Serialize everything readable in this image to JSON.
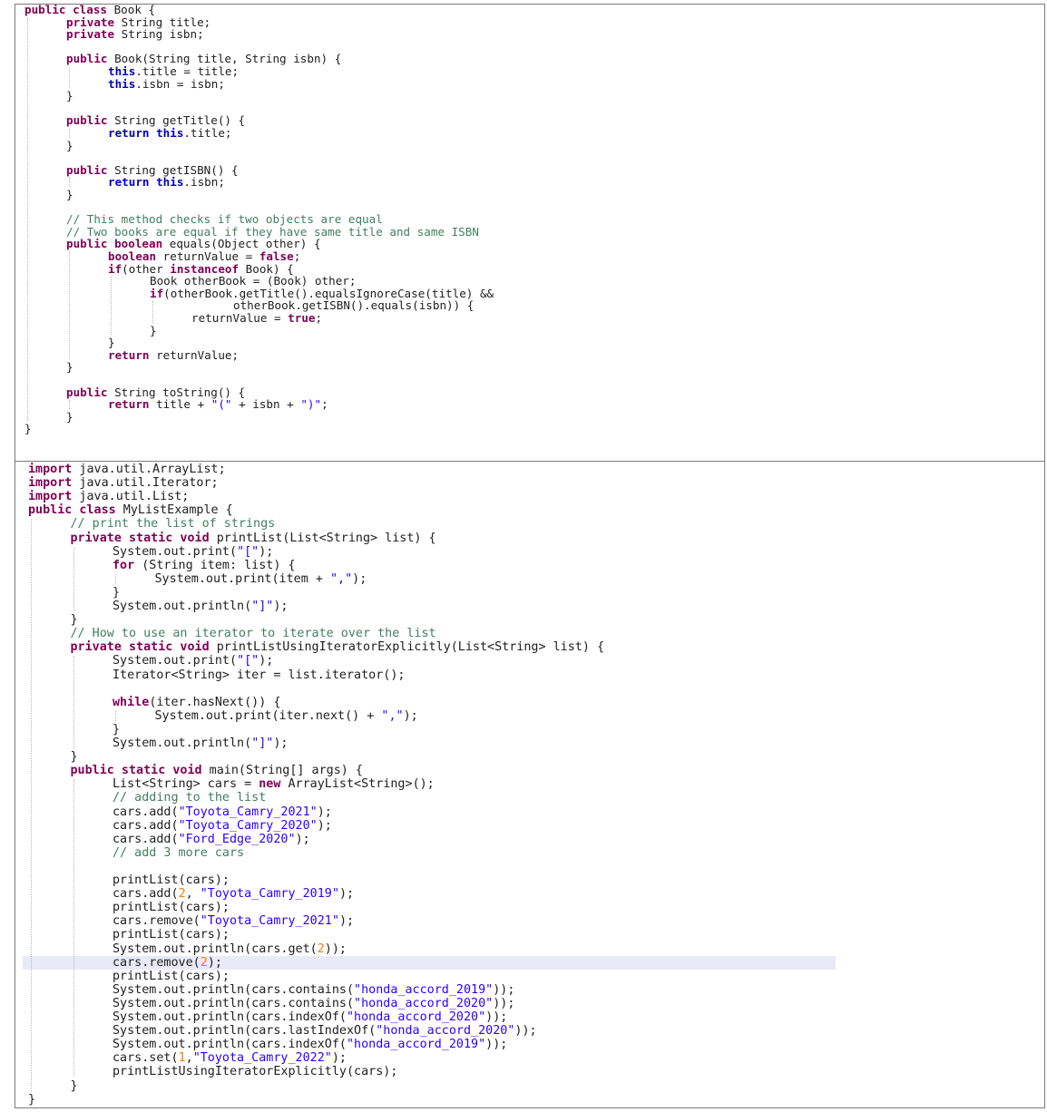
{
  "panel1": {
    "lines": [
      {
        "indent": 0,
        "tokens": [
          {
            "t": "public class",
            "c": "kw"
          },
          {
            "t": " Book {",
            "c": ""
          }
        ]
      },
      {
        "indent": 1,
        "tokens": [
          {
            "t": "private",
            "c": "kw"
          },
          {
            "t": " String title;",
            "c": ""
          }
        ]
      },
      {
        "indent": 1,
        "tokens": [
          {
            "t": "private",
            "c": "kw"
          },
          {
            "t": " String isbn;",
            "c": ""
          }
        ]
      },
      {
        "indent": 0,
        "tokens": []
      },
      {
        "indent": 1,
        "tokens": [
          {
            "t": "public",
            "c": "kw"
          },
          {
            "t": " Book(String title, String isbn) {",
            "c": ""
          }
        ]
      },
      {
        "indent": 2,
        "tokens": [
          {
            "t": "this",
            "c": "kw2"
          },
          {
            "t": ".title = title;",
            "c": ""
          }
        ]
      },
      {
        "indent": 2,
        "tokens": [
          {
            "t": "this",
            "c": "kw2"
          },
          {
            "t": ".isbn = isbn;",
            "c": ""
          }
        ]
      },
      {
        "indent": 1,
        "tokens": [
          {
            "t": "}",
            "c": ""
          }
        ]
      },
      {
        "indent": 0,
        "tokens": []
      },
      {
        "indent": 1,
        "tokens": [
          {
            "t": "public",
            "c": "kw"
          },
          {
            "t": " String getTitle() {",
            "c": ""
          }
        ]
      },
      {
        "indent": 2,
        "tokens": [
          {
            "t": "return this",
            "c": "kw2"
          },
          {
            "t": ".title;",
            "c": ""
          }
        ]
      },
      {
        "indent": 1,
        "tokens": [
          {
            "t": "}",
            "c": ""
          }
        ]
      },
      {
        "indent": 0,
        "tokens": []
      },
      {
        "indent": 1,
        "tokens": [
          {
            "t": "public",
            "c": "kw"
          },
          {
            "t": " String getISBN() {",
            "c": ""
          }
        ]
      },
      {
        "indent": 2,
        "tokens": [
          {
            "t": "return this",
            "c": "kw2"
          },
          {
            "t": ".isbn;",
            "c": ""
          }
        ]
      },
      {
        "indent": 1,
        "tokens": [
          {
            "t": "}",
            "c": ""
          }
        ]
      },
      {
        "indent": 0,
        "tokens": []
      },
      {
        "indent": 1,
        "tokens": [
          {
            "t": "// This method checks if two objects are equal",
            "c": "cm"
          }
        ]
      },
      {
        "indent": 1,
        "tokens": [
          {
            "t": "// Two books are equal if they have same title and same ISBN",
            "c": "cm"
          }
        ]
      },
      {
        "indent": 1,
        "tokens": [
          {
            "t": "public boolean",
            "c": "kw"
          },
          {
            "t": " equals(Object other) {",
            "c": ""
          }
        ]
      },
      {
        "indent": 2,
        "tokens": [
          {
            "t": "boolean",
            "c": "kw"
          },
          {
            "t": " returnValue = ",
            "c": ""
          },
          {
            "t": "false",
            "c": "kw"
          },
          {
            "t": ";",
            "c": ""
          }
        ]
      },
      {
        "indent": 2,
        "tokens": [
          {
            "t": "if",
            "c": "kw"
          },
          {
            "t": "(other ",
            "c": ""
          },
          {
            "t": "instanceof",
            "c": "kw"
          },
          {
            "t": " Book) {",
            "c": ""
          }
        ]
      },
      {
        "indent": 3,
        "tokens": [
          {
            "t": "Book otherBook = (Book) other;",
            "c": ""
          }
        ]
      },
      {
        "indent": 3,
        "tokens": [
          {
            "t": "if",
            "c": "kw"
          },
          {
            "t": "(otherBook.getTitle().equalsIgnoreCase(title) &&",
            "c": ""
          }
        ]
      },
      {
        "indent": 5,
        "tokens": [
          {
            "t": "otherBook.getISBN().equals(isbn)) {",
            "c": ""
          }
        ]
      },
      {
        "indent": 4,
        "tokens": [
          {
            "t": "returnValue = ",
            "c": ""
          },
          {
            "t": "true",
            "c": "kw"
          },
          {
            "t": ";",
            "c": ""
          }
        ]
      },
      {
        "indent": 3,
        "tokens": [
          {
            "t": "}",
            "c": ""
          }
        ]
      },
      {
        "indent": 2,
        "tokens": [
          {
            "t": "}",
            "c": ""
          }
        ]
      },
      {
        "indent": 2,
        "tokens": [
          {
            "t": "return",
            "c": "kw"
          },
          {
            "t": " returnValue;",
            "c": ""
          }
        ]
      },
      {
        "indent": 1,
        "tokens": [
          {
            "t": "}",
            "c": ""
          }
        ]
      },
      {
        "indent": 0,
        "tokens": []
      },
      {
        "indent": 1,
        "tokens": [
          {
            "t": "public",
            "c": "kw"
          },
          {
            "t": " String toString() {",
            "c": ""
          }
        ]
      },
      {
        "indent": 2,
        "tokens": [
          {
            "t": "return",
            "c": "kw"
          },
          {
            "t": " title + ",
            "c": ""
          },
          {
            "t": "\"(\"",
            "c": "st"
          },
          {
            "t": " + isbn + ",
            "c": ""
          },
          {
            "t": "\")\"",
            "c": "st"
          },
          {
            "t": ";",
            "c": ""
          }
        ]
      },
      {
        "indent": 1,
        "tokens": [
          {
            "t": "}",
            "c": ""
          }
        ]
      },
      {
        "indent": 0,
        "tokens": [
          {
            "t": "}",
            "c": ""
          }
        ]
      }
    ]
  },
  "panel2": {
    "highlight_line": 36,
    "lines": [
      {
        "indent": 0,
        "tokens": [
          {
            "t": "import",
            "c": "kw"
          },
          {
            "t": " java.util.ArrayList;",
            "c": ""
          }
        ]
      },
      {
        "indent": 0,
        "tokens": [
          {
            "t": "import",
            "c": "kw"
          },
          {
            "t": " java.util.Iterator;",
            "c": ""
          }
        ]
      },
      {
        "indent": 0,
        "tokens": [
          {
            "t": "import",
            "c": "kw"
          },
          {
            "t": " java.util.List;",
            "c": ""
          }
        ]
      },
      {
        "indent": 0,
        "tokens": [
          {
            "t": "public class",
            "c": "kw"
          },
          {
            "t": " MyListExample {",
            "c": ""
          }
        ]
      },
      {
        "indent": 1,
        "tokens": [
          {
            "t": "// print the list of strings",
            "c": "cm"
          }
        ]
      },
      {
        "indent": 1,
        "tokens": [
          {
            "t": "private static void",
            "c": "kw"
          },
          {
            "t": " printList(List<String> list) {",
            "c": ""
          }
        ]
      },
      {
        "indent": 2,
        "tokens": [
          {
            "t": "System.out.print(",
            "c": ""
          },
          {
            "t": "\"[\"",
            "c": "st"
          },
          {
            "t": ");",
            "c": ""
          }
        ]
      },
      {
        "indent": 2,
        "tokens": [
          {
            "t": "for",
            "c": "kw"
          },
          {
            "t": " (String item: list) {",
            "c": ""
          }
        ]
      },
      {
        "indent": 3,
        "tokens": [
          {
            "t": "System.out.print(item + ",
            "c": ""
          },
          {
            "t": "\",\"",
            "c": "st"
          },
          {
            "t": ");",
            "c": ""
          }
        ]
      },
      {
        "indent": 2,
        "tokens": [
          {
            "t": "}",
            "c": ""
          }
        ]
      },
      {
        "indent": 2,
        "tokens": [
          {
            "t": "System.out.println(",
            "c": ""
          },
          {
            "t": "\"]\"",
            "c": "st"
          },
          {
            "t": ");",
            "c": ""
          }
        ]
      },
      {
        "indent": 1,
        "tokens": [
          {
            "t": "}",
            "c": ""
          }
        ]
      },
      {
        "indent": 1,
        "tokens": [
          {
            "t": "// How to use an iterator to iterate over the list",
            "c": "cm"
          }
        ]
      },
      {
        "indent": 1,
        "tokens": [
          {
            "t": "private static void",
            "c": "kw"
          },
          {
            "t": " printListUsingIteratorExplicitly(List<String> list) {",
            "c": ""
          }
        ]
      },
      {
        "indent": 2,
        "tokens": [
          {
            "t": "System.out.print(",
            "c": ""
          },
          {
            "t": "\"[\"",
            "c": "st"
          },
          {
            "t": ");",
            "c": ""
          }
        ]
      },
      {
        "indent": 2,
        "tokens": [
          {
            "t": "Iterator<String> iter = list.iterator();",
            "c": ""
          }
        ]
      },
      {
        "indent": 0,
        "tokens": []
      },
      {
        "indent": 2,
        "tokens": [
          {
            "t": "while",
            "c": "kw"
          },
          {
            "t": "(iter.hasNext()) {",
            "c": ""
          }
        ]
      },
      {
        "indent": 3,
        "tokens": [
          {
            "t": "System.out.print(iter.next() + ",
            "c": ""
          },
          {
            "t": "\",\"",
            "c": "st"
          },
          {
            "t": ");",
            "c": ""
          }
        ]
      },
      {
        "indent": 2,
        "tokens": [
          {
            "t": "}",
            "c": ""
          }
        ]
      },
      {
        "indent": 2,
        "tokens": [
          {
            "t": "System.out.println(",
            "c": ""
          },
          {
            "t": "\"]\"",
            "c": "st"
          },
          {
            "t": ");",
            "c": ""
          }
        ]
      },
      {
        "indent": 1,
        "tokens": [
          {
            "t": "}",
            "c": ""
          }
        ]
      },
      {
        "indent": 1,
        "tokens": [
          {
            "t": "public static void",
            "c": "kw"
          },
          {
            "t": " main(String[] args) {",
            "c": ""
          }
        ]
      },
      {
        "indent": 2,
        "tokens": [
          {
            "t": "List<String> cars = ",
            "c": ""
          },
          {
            "t": "new",
            "c": "kw"
          },
          {
            "t": " ArrayList<String>();",
            "c": ""
          }
        ]
      },
      {
        "indent": 2,
        "tokens": [
          {
            "t": "// adding to the list",
            "c": "cm"
          }
        ]
      },
      {
        "indent": 2,
        "tokens": [
          {
            "t": "cars.add(",
            "c": ""
          },
          {
            "t": "\"Toyota_Camry_2021\"",
            "c": "st"
          },
          {
            "t": ");",
            "c": ""
          }
        ]
      },
      {
        "indent": 2,
        "tokens": [
          {
            "t": "cars.add(",
            "c": ""
          },
          {
            "t": "\"Toyota_Camry_2020\"",
            "c": "st"
          },
          {
            "t": ");",
            "c": ""
          }
        ]
      },
      {
        "indent": 2,
        "tokens": [
          {
            "t": "cars.add(",
            "c": ""
          },
          {
            "t": "\"Ford_Edge_2020\"",
            "c": "st"
          },
          {
            "t": ");",
            "c": ""
          }
        ]
      },
      {
        "indent": 2,
        "tokens": [
          {
            "t": "// add 3 more cars",
            "c": "cm"
          }
        ]
      },
      {
        "indent": 0,
        "tokens": []
      },
      {
        "indent": 2,
        "tokens": [
          {
            "t": "printList(cars);",
            "c": ""
          }
        ]
      },
      {
        "indent": 2,
        "tokens": [
          {
            "t": "cars.add(",
            "c": ""
          },
          {
            "t": "2",
            "c": "nm"
          },
          {
            "t": ", ",
            "c": ""
          },
          {
            "t": "\"Toyota_Camry_2019\"",
            "c": "st"
          },
          {
            "t": ");",
            "c": ""
          }
        ]
      },
      {
        "indent": 2,
        "tokens": [
          {
            "t": "printList(cars);",
            "c": ""
          }
        ]
      },
      {
        "indent": 2,
        "tokens": [
          {
            "t": "cars.remove(",
            "c": ""
          },
          {
            "t": "\"Toyota_Camry_2021\"",
            "c": "st"
          },
          {
            "t": ");",
            "c": ""
          }
        ]
      },
      {
        "indent": 2,
        "tokens": [
          {
            "t": "printList(cars);",
            "c": ""
          }
        ]
      },
      {
        "indent": 2,
        "tokens": [
          {
            "t": "System.out.println(cars.get(",
            "c": ""
          },
          {
            "t": "2",
            "c": "nm"
          },
          {
            "t": "));",
            "c": ""
          }
        ]
      },
      {
        "indent": 2,
        "tokens": [
          {
            "t": "cars.remove(",
            "c": ""
          },
          {
            "t": "2",
            "c": "nm"
          },
          {
            "t": ");",
            "c": ""
          }
        ]
      },
      {
        "indent": 2,
        "tokens": [
          {
            "t": "printList(cars);",
            "c": ""
          }
        ]
      },
      {
        "indent": 2,
        "tokens": [
          {
            "t": "System.out.println(cars.contains(",
            "c": ""
          },
          {
            "t": "\"honda_accord_2019\"",
            "c": "st"
          },
          {
            "t": "));",
            "c": ""
          }
        ]
      },
      {
        "indent": 2,
        "tokens": [
          {
            "t": "System.out.println(cars.contains(",
            "c": ""
          },
          {
            "t": "\"honda_accord_2020\"",
            "c": "st"
          },
          {
            "t": "));",
            "c": ""
          }
        ]
      },
      {
        "indent": 2,
        "tokens": [
          {
            "t": "System.out.println(cars.indexOf(",
            "c": ""
          },
          {
            "t": "\"honda_accord_2020\"",
            "c": "st"
          },
          {
            "t": "));",
            "c": ""
          }
        ]
      },
      {
        "indent": 2,
        "tokens": [
          {
            "t": "System.out.println(cars.lastIndexOf(",
            "c": ""
          },
          {
            "t": "\"honda_accord_2020\"",
            "c": "st"
          },
          {
            "t": "));",
            "c": ""
          }
        ]
      },
      {
        "indent": 2,
        "tokens": [
          {
            "t": "System.out.println(cars.indexOf(",
            "c": ""
          },
          {
            "t": "\"honda_accord_2019\"",
            "c": "st"
          },
          {
            "t": "));",
            "c": ""
          }
        ]
      },
      {
        "indent": 2,
        "tokens": [
          {
            "t": "cars.set(",
            "c": ""
          },
          {
            "t": "1",
            "c": "nm"
          },
          {
            "t": ",",
            "c": ""
          },
          {
            "t": "\"Toyota_Camry_2022\"",
            "c": "st"
          },
          {
            "t": ");",
            "c": ""
          }
        ]
      },
      {
        "indent": 2,
        "tokens": [
          {
            "t": "printListUsingIteratorExplicitly(cars);",
            "c": ""
          }
        ]
      },
      {
        "indent": 1,
        "tokens": [
          {
            "t": "}",
            "c": ""
          }
        ]
      },
      {
        "indent": 0,
        "tokens": [
          {
            "t": "}",
            "c": ""
          }
        ]
      }
    ]
  }
}
